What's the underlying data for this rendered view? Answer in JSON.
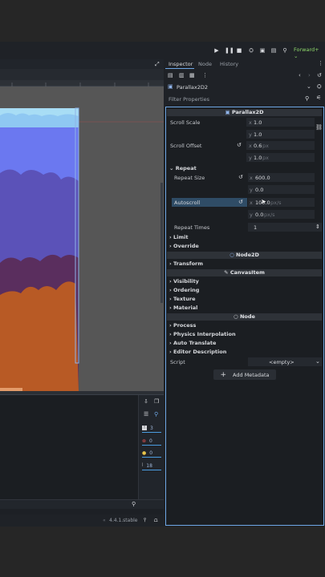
{
  "renderer": "Forward+",
  "dock": {
    "tabs": [
      "Inspector",
      "Node",
      "History"
    ]
  },
  "inspector": {
    "node_name": "Parallax2D2",
    "filter_placeholder": "Filter Properties",
    "class_header": "Parallax2D",
    "scroll_scale": {
      "label": "Scroll Scale",
      "x": "1.0",
      "y": "1.0"
    },
    "scroll_offset": {
      "label": "Scroll Offset",
      "x": "0.6",
      "y": "1.0",
      "unit": "px"
    },
    "repeat_group": "Repeat",
    "repeat_size": {
      "label": "Repeat Size",
      "x": "600.0",
      "y": "0.0"
    },
    "autoscroll": {
      "label": "Autoscroll",
      "x": "100.0",
      "y": "0.0",
      "unit": "px/s"
    },
    "repeat_times": {
      "label": "Repeat Times",
      "value": "1"
    },
    "groups_after": [
      "Limit",
      "Override"
    ],
    "node2d_header": "Node2D",
    "transform_group": "Transform",
    "canvasitem_header": "CanvasItem",
    "canvasitem_groups": [
      "Visibility",
      "Ordering",
      "Texture",
      "Material"
    ],
    "node_header": "Node",
    "node_groups": [
      "Process",
      "Physics Interpolation",
      "Auto Translate",
      "Editor Description"
    ],
    "script": {
      "label": "Script",
      "value": "<empty>"
    },
    "add_metadata": "Add Metadata"
  },
  "output": {
    "counts": {
      "messages": "3",
      "errors": "0",
      "warnings": "0",
      "total": "18"
    }
  },
  "status": {
    "version": "4.4.1.stable"
  },
  "colors": {
    "sky": "#6b78f0",
    "sky_top": "#8fd3f5",
    "far_clouds": "#5b52b8",
    "mid_clouds": "#5a2e5e",
    "ground": "#b85a25",
    "accent": "#6fa8e6",
    "selected": "#2f4c66"
  }
}
